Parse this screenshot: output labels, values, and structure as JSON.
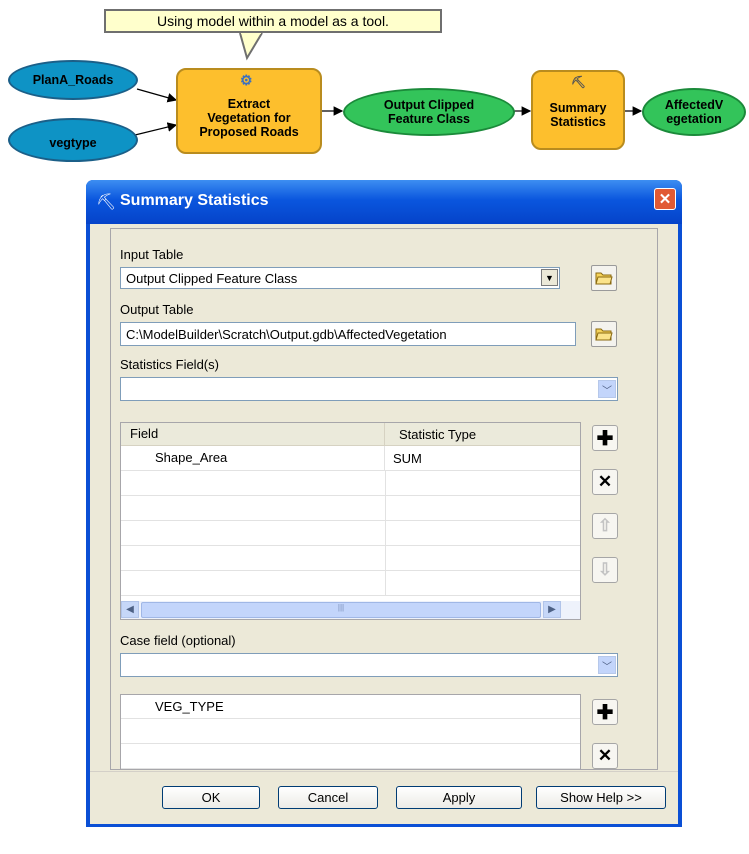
{
  "diagram": {
    "callout": "Using model within a model as a tool.",
    "inputs": [
      "PlanA_Roads",
      "vegtype"
    ],
    "model_tool": [
      "Extract",
      "Vegetation for",
      "Proposed Roads"
    ],
    "output_clipped": [
      "Output Clipped",
      "Feature Class"
    ],
    "summary_tool": [
      "Summary",
      "Statistics"
    ],
    "final_output": [
      "AffectedV",
      "egetation"
    ]
  },
  "dialog": {
    "title": "Summary Statistics",
    "input_table_label": "Input Table",
    "input_table_value": "Output Clipped Feature Class",
    "output_table_label": "Output Table",
    "output_table_value": "C:\\ModelBuilder\\Scratch\\Output.gdb\\AffectedVegetation",
    "statistics_fields_label": "Statistics Field(s)",
    "stats_grid": {
      "headers": [
        "Field",
        "Statistic Type"
      ],
      "rows": [
        {
          "field": "Shape_Area",
          "stat": "SUM"
        }
      ]
    },
    "case_field_label": "Case field (optional)",
    "case_list": [
      "VEG_TYPE"
    ],
    "buttons": {
      "ok": "OK",
      "cancel": "Cancel",
      "apply": "Apply",
      "help": "Show Help >>"
    }
  },
  "colors": {
    "input_ellipse": "#0e93c5",
    "output_ellipse": "#33c45a",
    "tool_box": "#fdbf2d",
    "callout": "#ffffcc",
    "titlebar": "#0a56de"
  }
}
